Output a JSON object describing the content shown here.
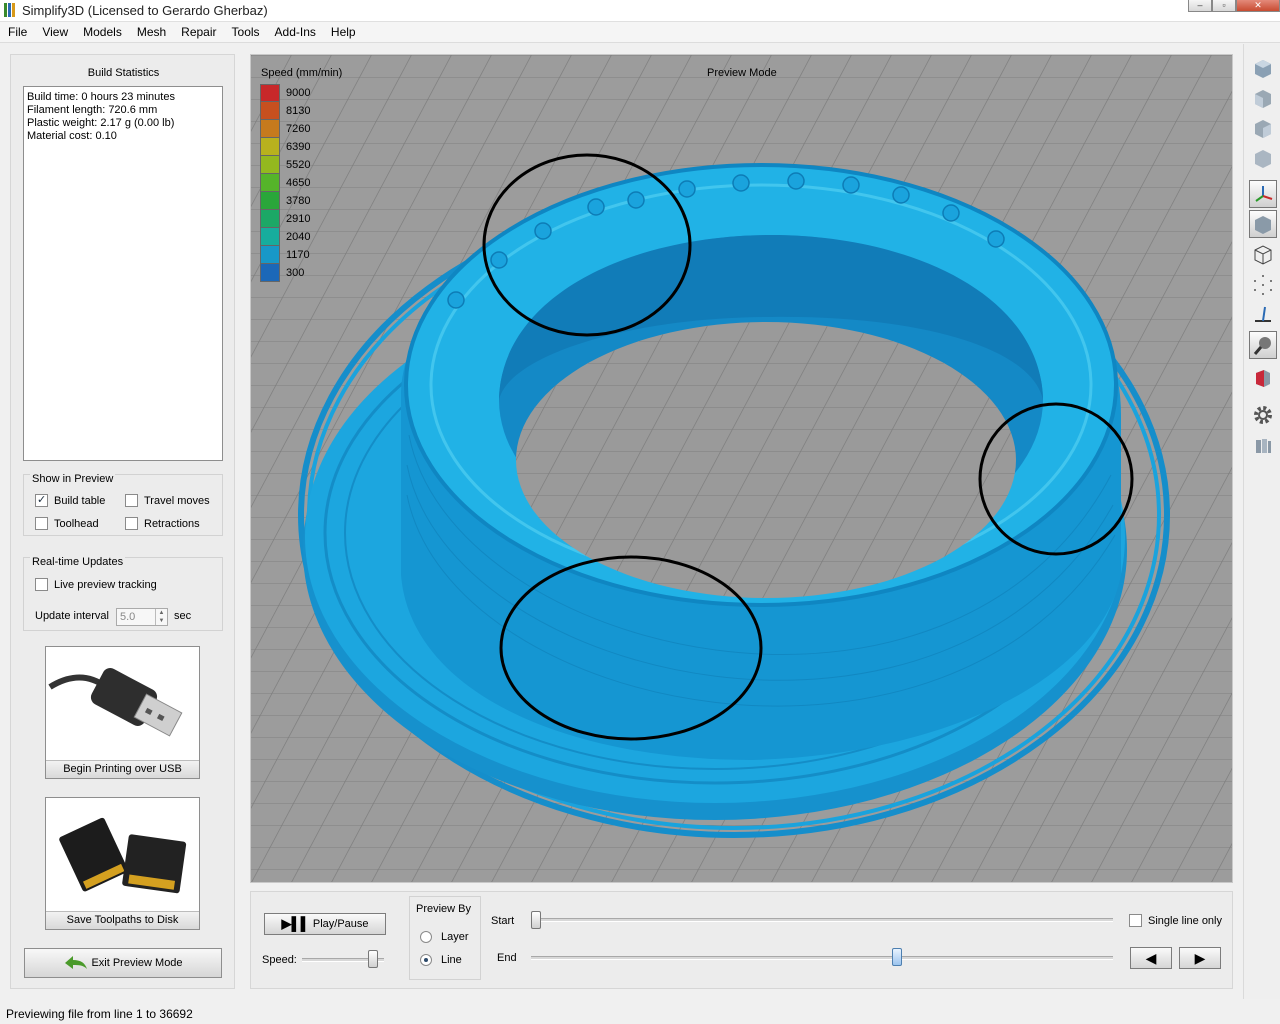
{
  "window": {
    "title": "Simplify3D (Licensed to Gerardo Gherbaz)",
    "controls": [
      "minimize",
      "maximize",
      "close"
    ]
  },
  "menu": [
    "File",
    "View",
    "Models",
    "Mesh",
    "Repair",
    "Tools",
    "Add-Ins",
    "Help"
  ],
  "build_statistics": {
    "title": "Build Statistics",
    "lines": [
      "Build time: 0 hours 23 minutes",
      "Filament length: 720.6 mm",
      "Plastic weight: 2.17 g (0.00 lb)",
      "Material cost: 0.10"
    ]
  },
  "show_in_preview": {
    "title": "Show in Preview",
    "build_table": {
      "label": "Build table",
      "checked": true
    },
    "travel_moves": {
      "label": "Travel moves",
      "checked": false
    },
    "toolhead": {
      "label": "Toolhead",
      "checked": false
    },
    "retractions": {
      "label": "Retractions",
      "checked": false
    }
  },
  "realtime_updates": {
    "title": "Real-time Updates",
    "live_preview": {
      "label": "Live preview tracking",
      "checked": false
    },
    "interval_label": "Update interval",
    "interval_value": "5.0",
    "interval_unit": "sec"
  },
  "actions": {
    "usb_label": "Begin Printing over USB",
    "sd_label": "Save Toolpaths to Disk",
    "exit_label": "Exit Preview Mode"
  },
  "viewport": {
    "legend_title": "Speed (mm/min)",
    "mode_label": "Preview Mode",
    "legend": [
      {
        "value": "9000",
        "color": "#c8282a"
      },
      {
        "value": "8130",
        "color": "#c8501f"
      },
      {
        "value": "7260",
        "color": "#c67a1d"
      },
      {
        "value": "6390",
        "color": "#b8b11e"
      },
      {
        "value": "5520",
        "color": "#94b81f"
      },
      {
        "value": "4650",
        "color": "#55b42a"
      },
      {
        "value": "3780",
        "color": "#2aa63a"
      },
      {
        "value": "2910",
        "color": "#1ca866"
      },
      {
        "value": "2040",
        "color": "#17ad9d"
      },
      {
        "value": "1170",
        "color": "#1898c8"
      },
      {
        "value": "300",
        "color": "#1c68b8"
      }
    ],
    "model_color": "#1a9fd8"
  },
  "playback": {
    "play_label": "Play/Pause",
    "speed_label": "Speed:",
    "preview_by_title": "Preview By",
    "preview_by_options": [
      {
        "label": "Layer",
        "selected": false
      },
      {
        "label": "Line",
        "selected": true
      }
    ],
    "start_label": "Start",
    "end_label": "End",
    "single_line_label": "Single line only",
    "single_line_checked": false
  },
  "right_toolbar": [
    "view-top-icon",
    "view-front-icon",
    "view-side-icon",
    "view-iso-icon",
    "axes-icon",
    "solid-view-icon",
    "wireframe-icon",
    "points-icon",
    "normals-icon",
    "lighting-icon",
    "cross-section-icon",
    "settings-gear-icon",
    "layers-icon"
  ],
  "status": {
    "text": "Previewing file from line 1 to 36692"
  }
}
